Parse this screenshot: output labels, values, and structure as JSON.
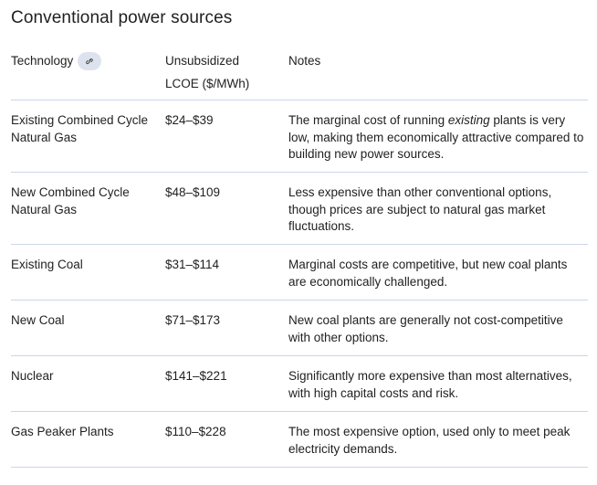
{
  "title": "Conventional power sources",
  "table": {
    "headers": {
      "technology": "Technology",
      "link_icon": "link-icon",
      "lcoe_line1": "Unsubsidized",
      "lcoe_line2": "LCOE ($/MWh)",
      "notes": "Notes"
    },
    "rows": [
      {
        "technology": "Existing Combined Cycle Natural Gas",
        "lcoe": "$24–$39",
        "notes_pre": "The marginal cost of running ",
        "notes_em": "existing",
        "notes_post": " plants is very low, making them economically attractive compared to building new power sources."
      },
      {
        "technology": "New Combined Cycle Natural Gas",
        "lcoe": "$48–$109",
        "notes": "Less expensive than other conventional options, though prices are subject to natural gas market fluctuations."
      },
      {
        "technology": "Existing Coal",
        "lcoe": "$31–$114",
        "notes": "Marginal costs are competitive, but new coal plants are economically challenged."
      },
      {
        "technology": "New Coal",
        "lcoe": "$71–$173",
        "notes": "New coal plants are generally not cost-competitive with other options."
      },
      {
        "technology": "Nuclear",
        "lcoe": "$141–$221",
        "notes": "Significantly more expensive than most alternatives, with high capital costs and risk."
      },
      {
        "technology": "Gas Peaker Plants",
        "lcoe": "$110–$228",
        "notes": "The most expensive option, used only to meet peak electricity demands."
      }
    ]
  },
  "colors": {
    "text": "#1f1f1f",
    "divider": "#c9d6ea",
    "chip_bg": "#dde3ee"
  }
}
